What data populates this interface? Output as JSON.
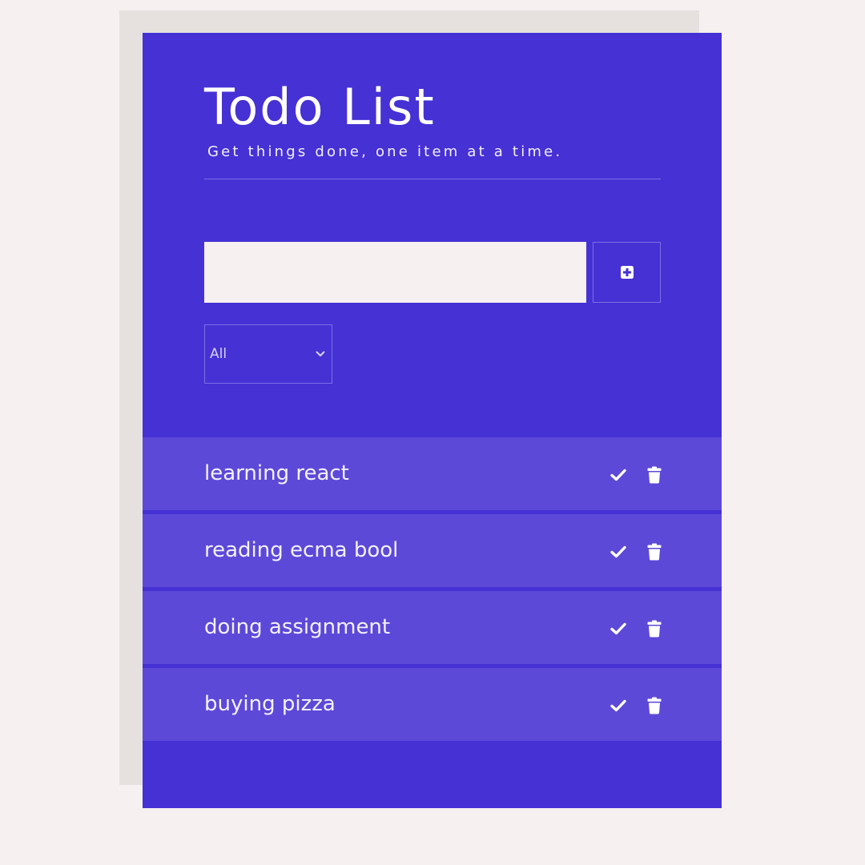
{
  "app": {
    "title": "Todo List",
    "subtitle": "Get things done, one item at a time."
  },
  "form": {
    "input_value": "",
    "input_placeholder": "",
    "add_icon": "plus-square-icon",
    "filter": {
      "selected": "All",
      "options": [
        "All"
      ]
    }
  },
  "todos": [
    {
      "text": "learning react"
    },
    {
      "text": "reading ecma bool"
    },
    {
      "text": "doing assignment"
    },
    {
      "text": "buying pizza"
    }
  ],
  "icons": {
    "complete": "check-icon",
    "delete": "trash-icon"
  },
  "colors": {
    "background": "#f6f0f0",
    "card": "#4531d4",
    "item": "#5c49d8",
    "shadow": "#e6e1df",
    "text": "#ffffff"
  }
}
